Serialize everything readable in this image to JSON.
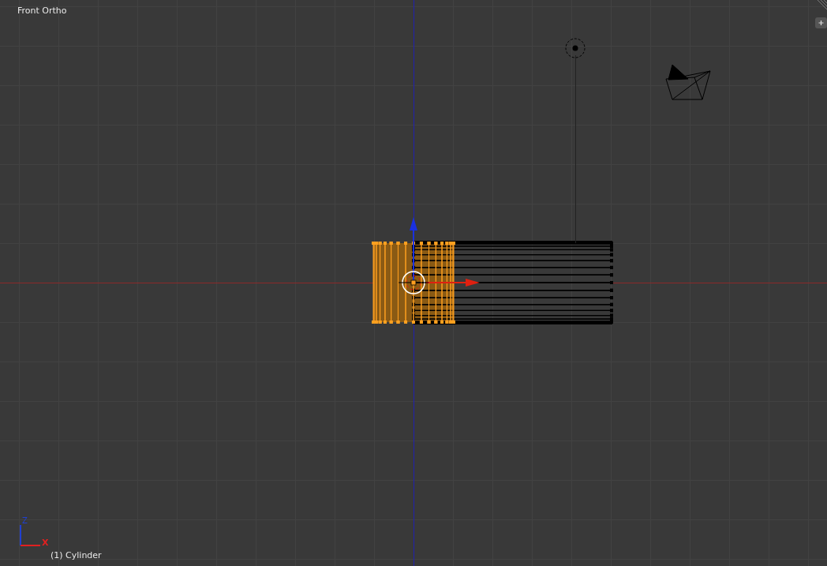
{
  "viewport": {
    "view_name": "Front Ortho",
    "object_info": "(1) Cylinder",
    "axis_labels": [
      {
        "label": "Z",
        "color": "#2040d0"
      },
      {
        "label": "X",
        "color": "#e02020"
      }
    ]
  }
}
